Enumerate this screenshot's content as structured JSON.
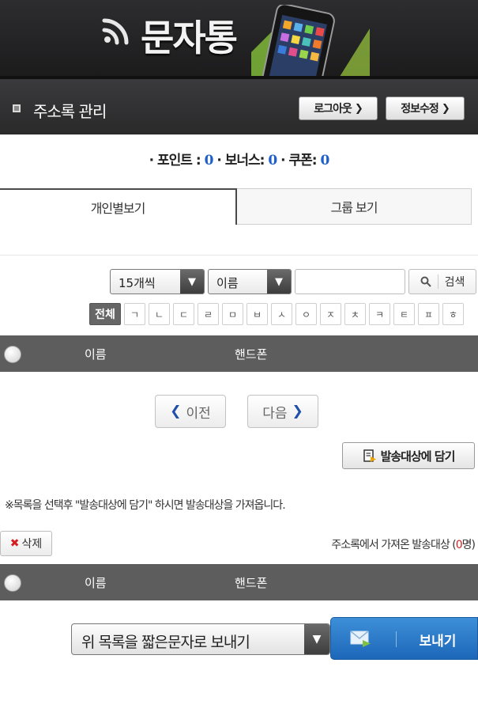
{
  "header": {
    "app_name": "문자통",
    "page_title": "주소록 관리",
    "logout_label": "로그아웃",
    "profile_label": "정보수정"
  },
  "points": {
    "point_label": "· 포인트 :",
    "point_value": "0",
    "bonus_label": "· 보너스:",
    "bonus_value": "0",
    "coupon_label": "· 쿠폰:",
    "coupon_value": "0"
  },
  "tabs": [
    {
      "label": "개인별보기",
      "active": true
    },
    {
      "label": "그룹 보기",
      "active": false
    }
  ],
  "search": {
    "count_select": "15개씩",
    "field_select": "이름",
    "input_value": "",
    "button_label": "검색"
  },
  "initials": [
    "전체",
    "ㄱ",
    "ㄴ",
    "ㄷ",
    "ㄹ",
    "ㅁ",
    "ㅂ",
    "ㅅ",
    "ㅇ",
    "ㅈ",
    "ㅊ",
    "ㅋ",
    "ㅌ",
    "ㅍ",
    "ㅎ"
  ],
  "list": {
    "col_name": "이름",
    "col_phone": "핸드폰"
  },
  "pagination": {
    "prev_label": "이전",
    "next_label": "다음"
  },
  "add_button_label": "발송대상에 담기",
  "note": "※목록을 선택후 \"발송대상에 담기\" 하시면 발송대상을 가져옵니다.",
  "delete_label": "삭제",
  "targets": {
    "prefix": "주소록에서 가져온 발송대상 (",
    "count": "0",
    "suffix": "명)"
  },
  "target_list": {
    "col_name": "이름",
    "col_phone": "핸드폰"
  },
  "send": {
    "select_value": "위 목록을 짧은문자로 보내기",
    "button_label": "보내기"
  },
  "colors": {
    "accent_blue": "#1f5fc9",
    "send_button": "#2a7bc9",
    "count_red": "#d42020",
    "header_dark": "#2a2a2b"
  }
}
